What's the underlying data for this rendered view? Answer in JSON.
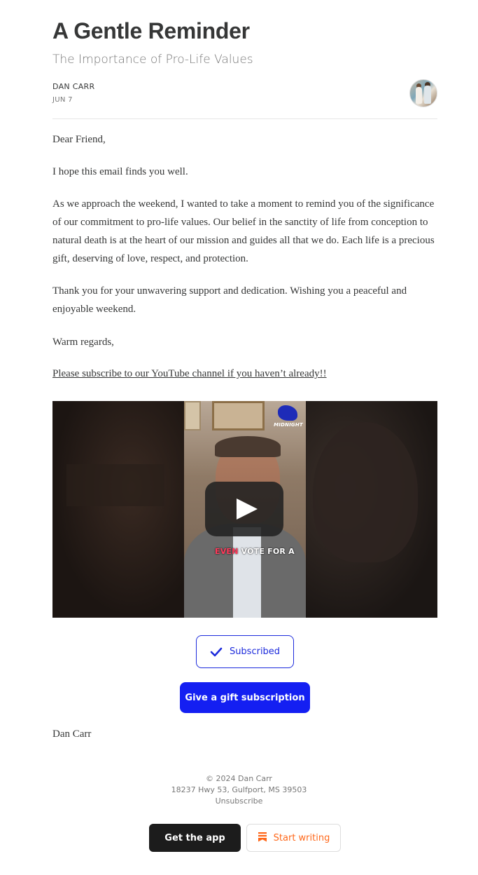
{
  "post": {
    "title": "A Gentle Reminder",
    "subtitle": "The Importance of Pro-Life Values",
    "author": "DAN CARR",
    "date": "JUN 7"
  },
  "body": {
    "greeting": "Dear Friend,",
    "hope": "I hope this email finds you well.",
    "main": "As we approach the weekend, I wanted to take a moment to remind you of the significance of our commitment to pro-life values. Our belief in the sanctity of life from conception to natural death is at the heart of our mission and guides all that we do. Each life is a precious gift, deserving of love, respect, and protection.",
    "thanks": "Thank you for your unwavering support and dedication. Wishing you a peaceful and enjoyable weekend.",
    "regards": "Warm regards,",
    "youtube_link": "Please subscribe to our YouTube channel if you haven’t already!!"
  },
  "video": {
    "caption_highlight": "EVEN",
    "caption_rest": " VOTE FOR A",
    "channel_logo_text": "MIDNIGHT",
    "play_icon": "play-icon"
  },
  "actions": {
    "subscribed_label": "Subscribed",
    "gift_label": "Give a gift subscription"
  },
  "signature": "Dan Carr",
  "footer": {
    "copyright": "© 2024 Dan Carr",
    "address": "18237 Hwy 53, Gulfport, MS 39503",
    "unsubscribe": "Unsubscribe",
    "get_app_label": "Get the app",
    "start_writing_label": "Start writing"
  },
  "colors": {
    "accent": "#141ff2",
    "writing_accent": "#ff6719",
    "dark_button": "#1c1c1c"
  }
}
